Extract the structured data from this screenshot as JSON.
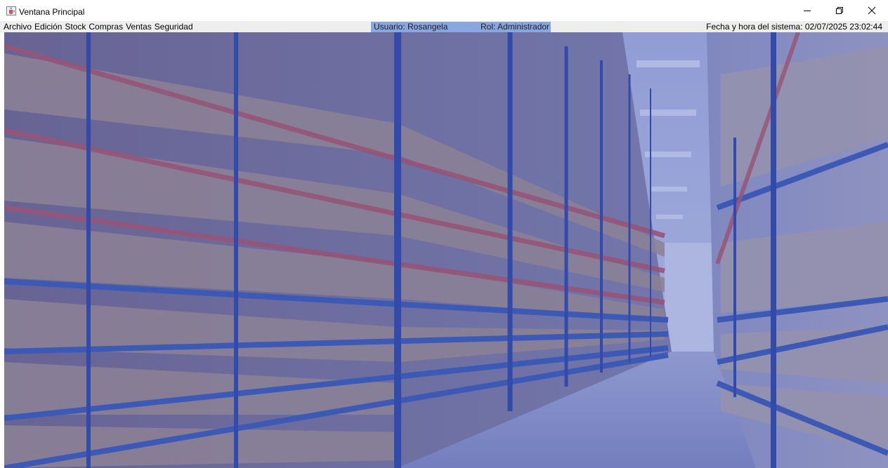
{
  "window": {
    "title": "Ventana Principal",
    "icon": "java-cup-icon"
  },
  "menu": [
    {
      "label": "Archivo"
    },
    {
      "label": "Edición"
    },
    {
      "label": "Stock"
    },
    {
      "label": "Compras"
    },
    {
      "label": "Ventas"
    },
    {
      "label": "Seguridad"
    }
  ],
  "status": {
    "user": "Usuario: Rosangela",
    "role": "Rol: Administrador",
    "datetime": "Fecha y hora del sistema: 02/07/2025 23:02:44",
    "highlight_color": "#8aa6e0"
  },
  "background": {
    "overlay_color": "#3c4fb0",
    "image": "warehouse-shelves-photo"
  }
}
